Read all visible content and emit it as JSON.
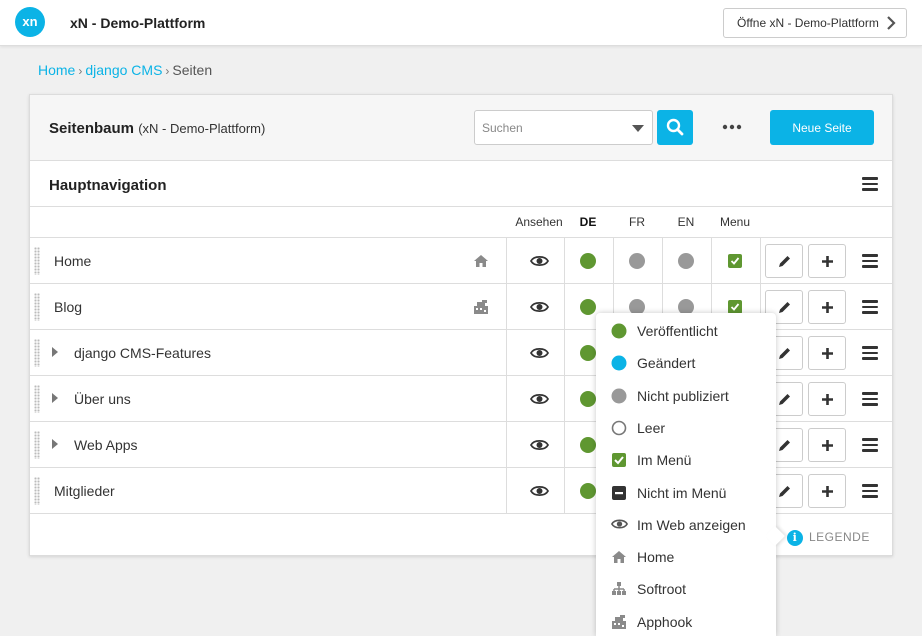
{
  "topbar": {
    "logo_text": "xn",
    "site_title": "xN - Demo-Plattform",
    "open_site_label": "Öffne xN - Demo-Plattform"
  },
  "breadcrumb": {
    "home": "Home",
    "cms": "django CMS",
    "current": "Seiten",
    "separator": "›"
  },
  "header": {
    "title": "Seitenbaum",
    "subtitle": "(xN - Demo-Plattform)",
    "search_placeholder": "Suchen",
    "new_page_label": "Neue Seite"
  },
  "section": {
    "title": "Hauptnavigation"
  },
  "columns": {
    "view": "Ansehen",
    "de": "DE",
    "fr": "FR",
    "en": "EN",
    "menu": "Menu"
  },
  "colors": {
    "accent": "#0bb3e6",
    "published": "#5f9731",
    "changed": "#0bb3e6",
    "unpublished": "#999999"
  },
  "rows": [
    {
      "label": "Home",
      "expandable": false,
      "type_icon": "home-icon",
      "de": "published",
      "fr": "unpublished",
      "en": "unpublished",
      "in_menu": true
    },
    {
      "label": "Blog",
      "expandable": false,
      "type_icon": "apphook-icon",
      "de": "published",
      "fr": "unpublished",
      "en": "unpublished",
      "in_menu": true
    },
    {
      "label": "django CMS-Features",
      "expandable": true,
      "type_icon": "",
      "de": "published",
      "fr": "",
      "en": "",
      "in_menu": true
    },
    {
      "label": "Über uns",
      "expandable": true,
      "type_icon": "",
      "de": "published",
      "fr": "",
      "en": "",
      "in_menu": true
    },
    {
      "label": "Web Apps",
      "expandable": true,
      "type_icon": "",
      "de": "published",
      "fr": "",
      "en": "",
      "in_menu": true
    },
    {
      "label": "Mitglieder",
      "expandable": false,
      "type_icon": "",
      "de": "published",
      "fr": "",
      "en": "",
      "in_menu": true
    }
  ],
  "legend": {
    "toggle_label": "LEGENDE",
    "info_glyph": "i",
    "items": [
      {
        "label": "Veröffentlicht",
        "icon": "published-dot-icon"
      },
      {
        "label": "Geändert",
        "icon": "changed-dot-icon"
      },
      {
        "label": "Nicht publiziert",
        "icon": "unpublished-dot-icon"
      },
      {
        "label": "Leer",
        "icon": "empty-dot-icon"
      },
      {
        "label": "Im Menü",
        "icon": "checkbox-checked-icon"
      },
      {
        "label": "Nicht im Menü",
        "icon": "checkbox-minus-icon"
      },
      {
        "label": "Im Web anzeigen",
        "icon": "eye-icon"
      },
      {
        "label": "Home",
        "icon": "home-icon"
      },
      {
        "label": "Softroot",
        "icon": "softroot-icon"
      },
      {
        "label": "Apphook",
        "icon": "apphook-icon"
      }
    ]
  }
}
